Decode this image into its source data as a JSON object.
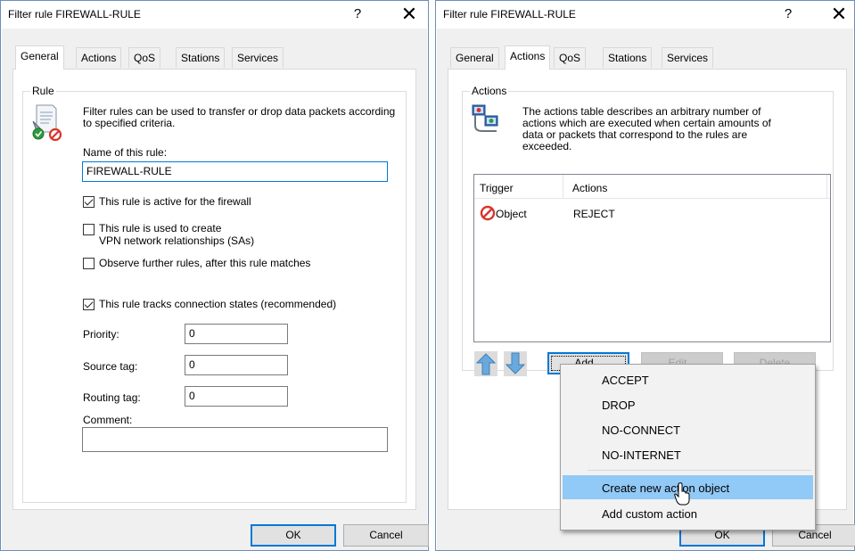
{
  "left_dialog": {
    "title": "Filter rule FIREWALL-RULE",
    "help": "?",
    "close": "✕",
    "tabs": [
      "General",
      "Actions",
      "QoS",
      "Stations",
      "Services"
    ],
    "active_tab": "General",
    "group_title": "Rule",
    "description": "Filter rules can be used to transfer or drop data packets according to specified criteria.",
    "name_label": "Name of this rule:",
    "name_value": "FIREWALL-RULE",
    "checkboxes": [
      {
        "label": "This rule is active for the firewall",
        "checked": true
      },
      {
        "label": "This rule is used to create VPN network relationships (SAs)",
        "line1": "This rule is used to create",
        "line2": "VPN network relationships (SAs)",
        "checked": false
      },
      {
        "label": "Observe further rules, after this rule matches",
        "checked": false
      },
      {
        "label": "This rule tracks connection states (recommended)",
        "checked": true
      }
    ],
    "priority": {
      "label": "Priority:",
      "value": "0"
    },
    "source_tag": {
      "label": "Source tag:",
      "value": "0"
    },
    "routing_tag": {
      "label": "Routing tag:",
      "value": "0"
    },
    "comment": {
      "label": "Comment:",
      "value": ""
    },
    "ok": "OK",
    "cancel": "Cancel"
  },
  "right_dialog": {
    "title": "Filter rule FIREWALL-RULE",
    "help": "?",
    "close": "✕",
    "tabs": [
      "General",
      "Actions",
      "QoS",
      "Stations",
      "Services"
    ],
    "active_tab": "Actions",
    "group_title": "Actions",
    "description": "The actions table describes an arbitrary number of actions which are executed when certain amounts of data or packets that correspond to the rules are exceeded.",
    "desc_lines": [
      "The actions table describes an arbitrary number of",
      "actions which are executed when certain amounts of",
      "data or packets that correspond to the rules are",
      "exceeded."
    ],
    "table": {
      "columns": [
        "Trigger",
        "Actions"
      ],
      "rows": [
        {
          "trigger": "Object",
          "action": "REJECT"
        }
      ]
    },
    "add": "Add...",
    "edit": "Edit...",
    "delete": "Delete",
    "ok": "OK",
    "cancel": "Cancel"
  },
  "context_menu": {
    "items": [
      "ACCEPT",
      "DROP",
      "NO-CONNECT",
      "NO-INTERNET"
    ],
    "create": "Create new action object",
    "custom": "Add custom action",
    "hovered": "Create new action object"
  },
  "colors": {
    "accent": "#0078d7",
    "menu_hover": "#91c9f7",
    "reject_red": "#d9342b"
  },
  "icons": [
    "filter-rule-icon",
    "actions-table-icon",
    "reject-icon",
    "arrow-up-icon",
    "arrow-down-icon",
    "mouse-cursor-icon"
  ]
}
